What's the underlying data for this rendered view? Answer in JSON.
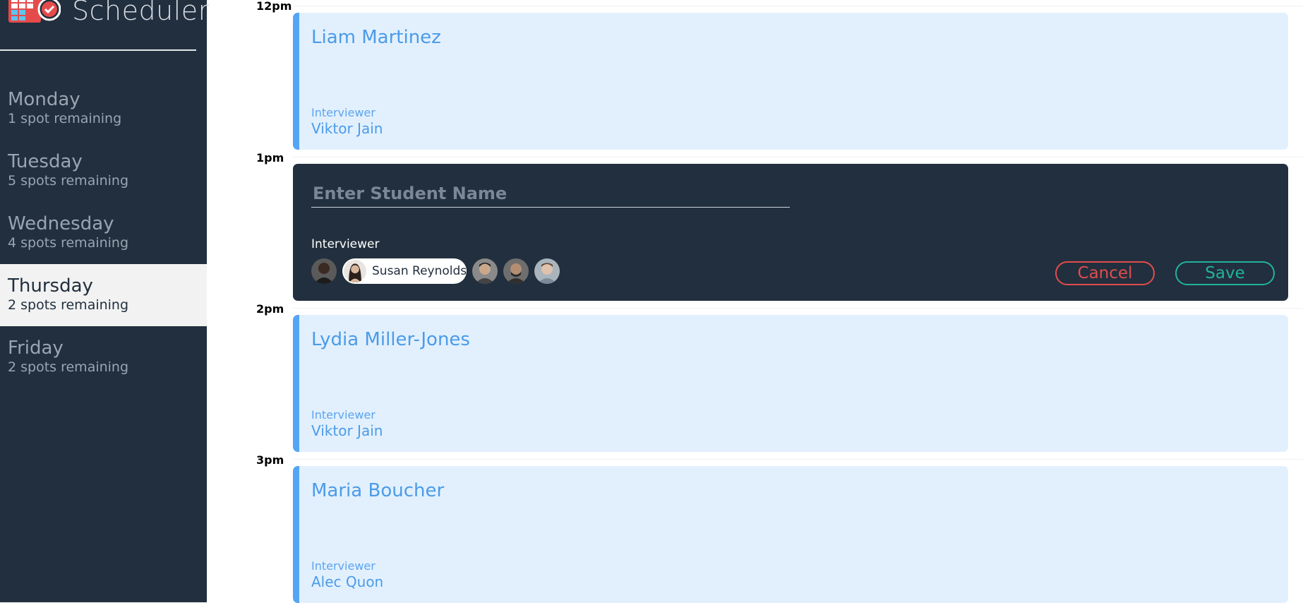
{
  "app": {
    "title": "Scheduler"
  },
  "sidebar": {
    "days": [
      {
        "name": "Monday",
        "spots": "1 spot remaining"
      },
      {
        "name": "Tuesday",
        "spots": "5 spots remaining"
      },
      {
        "name": "Wednesday",
        "spots": "4 spots remaining"
      },
      {
        "name": "Thursday",
        "spots": "2 spots remaining",
        "selected": true
      },
      {
        "name": "Friday",
        "spots": "2 spots remaining"
      }
    ]
  },
  "schedule": {
    "times": [
      "12pm",
      "1pm",
      "2pm",
      "3pm"
    ],
    "appointments": [
      {
        "student": "Liam Martinez",
        "interviewer_label": "Interviewer",
        "interviewer": "Viktor Jain"
      },
      {
        "student": "Lydia Miller-Jones",
        "interviewer_label": "Interviewer",
        "interviewer": "Viktor Jain"
      },
      {
        "student": "Maria Boucher",
        "interviewer_label": "Interviewer",
        "interviewer": "Alec Quon"
      }
    ],
    "form": {
      "placeholder": "Enter Student Name",
      "interviewer_label": "Interviewer",
      "selected_interviewer": "Susan Reynolds",
      "cancel_label": "Cancel",
      "save_label": "Save"
    }
  },
  "colors": {
    "sidebar_bg": "#222f3e",
    "appointment_bg": "#e2f0fe",
    "appointment_accent": "#55a5f5",
    "cancel": "#e14d4d",
    "save": "#20b39a"
  }
}
